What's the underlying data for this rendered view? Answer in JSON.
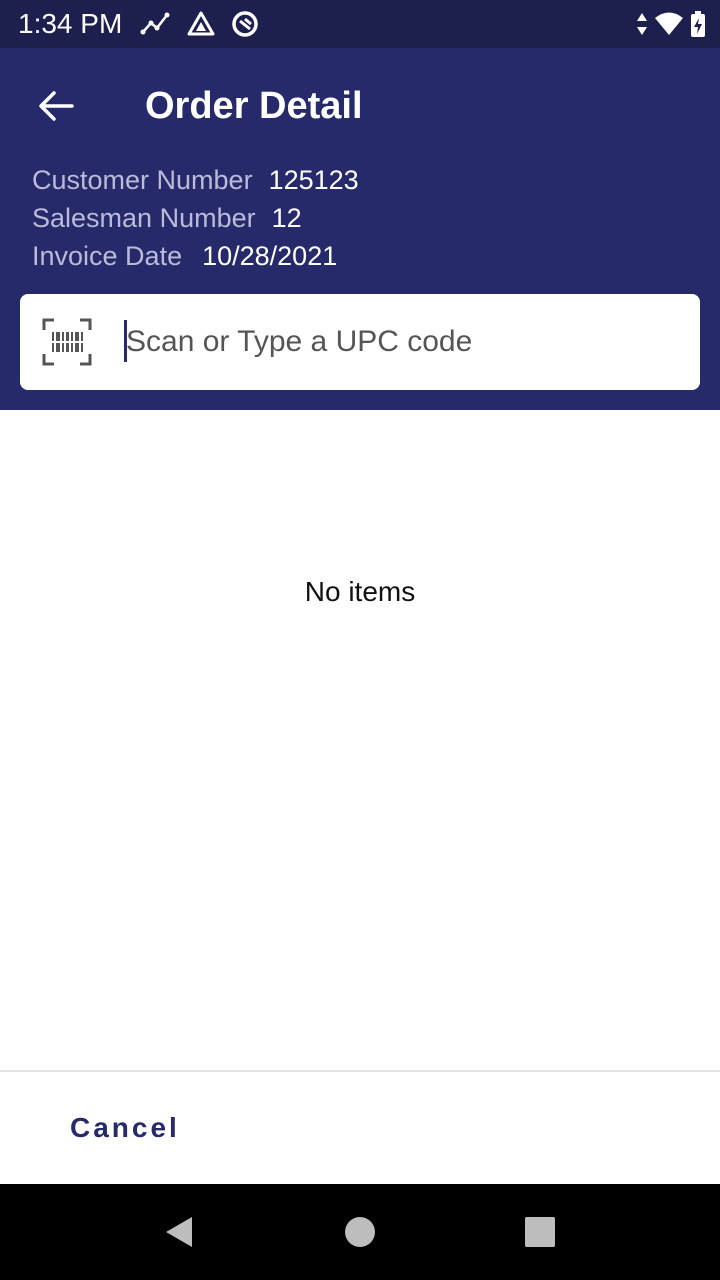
{
  "status_bar": {
    "time": "1:34 PM",
    "left_icons": [
      "chart-line-icon",
      "triangle-logo-icon",
      "circle-logo-icon"
    ],
    "right_icons": [
      "data-arrows-icon",
      "wifi-icon",
      "battery-charging-icon"
    ]
  },
  "header": {
    "title": "Order Detail",
    "back_icon": "arrow-back-icon",
    "background": "#262a6b"
  },
  "order_info": {
    "customer_label": "Customer Number",
    "customer_value": "125123",
    "salesman_label": "Salesman Number",
    "salesman_value": "12",
    "invoice_label": "Invoice Date",
    "invoice_value": "10/28/2021"
  },
  "search": {
    "placeholder": "Scan or Type a UPC code",
    "value": "",
    "icon": "barcode-scan-icon"
  },
  "content": {
    "empty_text": "No items"
  },
  "footer": {
    "cancel_label": "Cancel"
  },
  "nav_bar": {
    "icons": [
      "nav-back-icon",
      "nav-home-icon",
      "nav-recent-icon"
    ]
  }
}
